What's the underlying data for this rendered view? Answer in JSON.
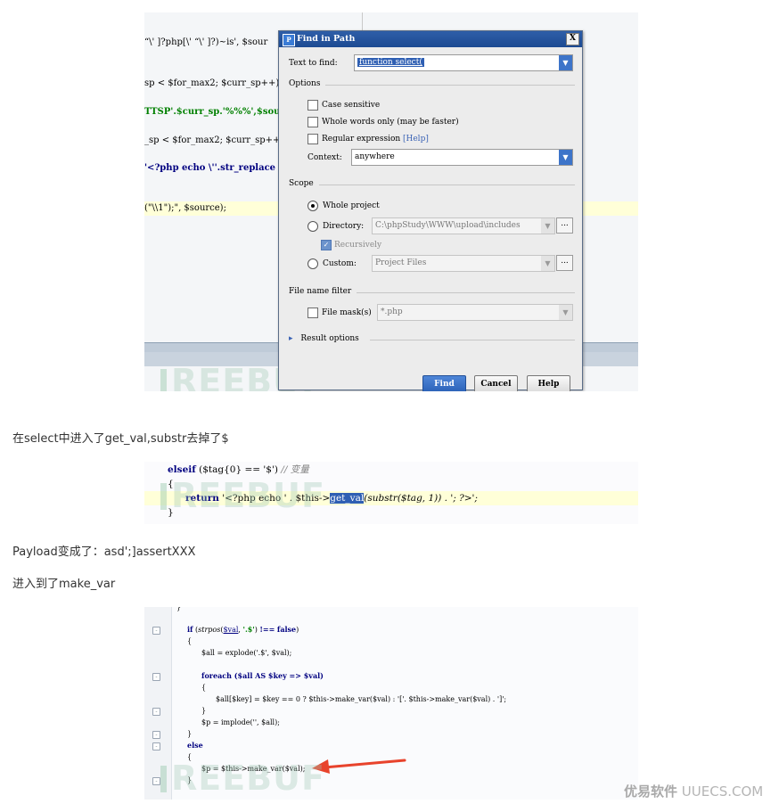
{
  "shot1": {
    "code_lines": [
      "“\\' ]?php[\\' “\\' ]?)~is', $sour",
      "sp < $for_max2; $curr_sp++)",
      "TTSP'.$curr_sp.'%%%',$source)",
      "_sp < $for_max2; $curr_sp++)",
      "'<?php echo \\''.str_replace",
      "(\"\\\\1\");\", $source);"
    ],
    "dialog": {
      "title": "Find in Path",
      "app_icon": "php-icon",
      "close_label": "X",
      "text_to_find_label": "Text to find:",
      "text_to_find_value": "function select(",
      "options_header": "Options",
      "case_sensitive": "Case sensitive",
      "whole_words": "Whole words only (may be faster)",
      "regex": "Regular expression",
      "regex_help": "[Help]",
      "context_label": "Context:",
      "context_value": "anywhere",
      "scope_header": "Scope",
      "whole_project": "Whole project",
      "directory_label": "Directory:",
      "directory_value": "C:\\phpStudy\\WWW\\upload\\includes",
      "recursively": "Recursively",
      "custom_label": "Custom:",
      "custom_value": "Project Files",
      "file_name_filter_header": "File name filter",
      "file_mask_label": "File mask(s)",
      "file_mask_value": "*.php",
      "result_options": "Result options",
      "find_button": "Find",
      "cancel_button": "Cancel",
      "help_button": "Help",
      "ellipsis": "..."
    }
  },
  "watermark": "REEBUF",
  "captions": {
    "c1": "在select中进入了get_val,substr去掉了$",
    "c2": "Payload变成了：asd';]assertXXX",
    "c3": "进入到了make_var"
  },
  "shot2": {
    "line1_kw": "elseif",
    "line1_rest": " ($tag{0} == '$') ",
    "line1_comment": "// 变量",
    "brace_open": "{",
    "line3_kw": "return",
    "line3_a": " '<?php echo ' . $this->",
    "line3_sel": "get_val",
    "line3_b": "(substr($tag, 1)) . '; ?>';",
    "brace_close": "}"
  },
  "shot3": {
    "lines": [
      "}",
      "if (strpos($val, '.$') !== false)",
      "{",
      "$all = explode('.$', $val);",
      "",
      "foreach ($all AS $key => $val)",
      "{",
      "$all[$key] = $key == 0 ? $this->make_var($val) : '['. $this->make_var($val) . ']';",
      "}",
      "$p = implode('', $all);",
      "}",
      "else",
      "{",
      "$p = $this->make_var($val);",
      "}"
    ]
  },
  "footer": {
    "brand_cn": "优易软件",
    "brand_en": "UUECS.COM"
  },
  "colors": {
    "accent": "#2f5fb3",
    "arrow": "#e8432c",
    "highlight_line": "#ffffd8"
  }
}
